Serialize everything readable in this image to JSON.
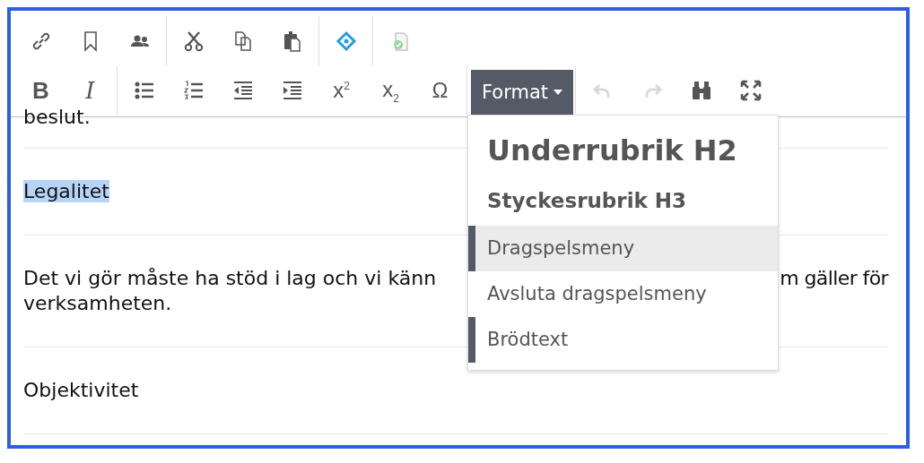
{
  "toolbar": {
    "rows": [
      {
        "groups": [
          {
            "items": [
              {
                "kind": "icon",
                "disabled": false
              },
              {
                "kind": "icon",
                "disabled": false
              },
              {
                "kind": "icon",
                "disabled": false
              }
            ]
          },
          {
            "items": [
              {
                "kind": "icon",
                "disabled": false
              },
              {
                "kind": "icon",
                "disabled": false
              },
              {
                "kind": "icon",
                "disabled": false
              }
            ]
          },
          {
            "items": [
              {
                "kind": "icon",
                "disabled": false
              }
            ]
          },
          {
            "items": [
              {
                "kind": "icon",
                "disabled": true
              }
            ]
          }
        ]
      },
      {
        "groups": [
          {
            "items": [
              {
                "kind": "glyph",
                "text": "B",
                "disabled": false
              },
              {
                "kind": "glyph",
                "text": "I",
                "disabled": false
              }
            ]
          },
          {
            "items": [
              {
                "kind": "icon",
                "disabled": false
              },
              {
                "kind": "icon",
                "disabled": false
              },
              {
                "kind": "icon",
                "disabled": false
              },
              {
                "kind": "icon",
                "disabled": false
              },
              {
                "kind": "glyph",
                "text": "x$^{2}$",
                "disabled": false
              },
              {
                "kind": "glyph",
                "text": "x$_{2}$",
                "disabled": false
              },
              {
                "kind": "glyph",
                "text": "Ω",
                "disabled": false
              }
            ]
          },
          {
            "items": [
              {
                "kind": "dropdown",
                "text": "Format",
                "expanded": true
              }
            ]
          },
          {
            "items": [
              {
                "kind": "icon",
                "disabled": true
              },
              {
                "kind": "icon",
                "disabled": true
              },
              {
                "kind": "icon",
                "disabled": false
              },
              {
                "kind": "icon",
                "disabled": false
              }
            ]
          }
        ]
      }
    ]
  },
  "format_menu": {
    "items": [
      {
        "kind": "h2",
        "text": "Underrubrik H2",
        "marked": false,
        "highlighted": false
      },
      {
        "kind": "h3",
        "text": "Styckesrubrik H3",
        "marked": false,
        "highlighted": false
      },
      {
        "kind": "item",
        "text": "Dragspelsmeny",
        "marked": true,
        "highlighted": true
      },
      {
        "kind": "item",
        "text": "Avsluta dragspelsmeny",
        "marked": false,
        "highlighted": false
      },
      {
        "kind": "item",
        "text": "Brödtext",
        "marked": true,
        "highlighted": false
      }
    ]
  },
  "content": {
    "paragraphs": [
      {
        "kind": "cut_top",
        "text": "beslut."
      },
      {
        "kind": "plain",
        "text": "Legalitet",
        "selected": true
      },
      {
        "kind": "covered",
        "left": "Det vi gör måste ha stöd i lag och vi känn",
        "right": "m gäller för",
        "line2": "verksamheten."
      },
      {
        "kind": "plain",
        "text": "Objektivitet",
        "selected": false
      }
    ]
  }
}
